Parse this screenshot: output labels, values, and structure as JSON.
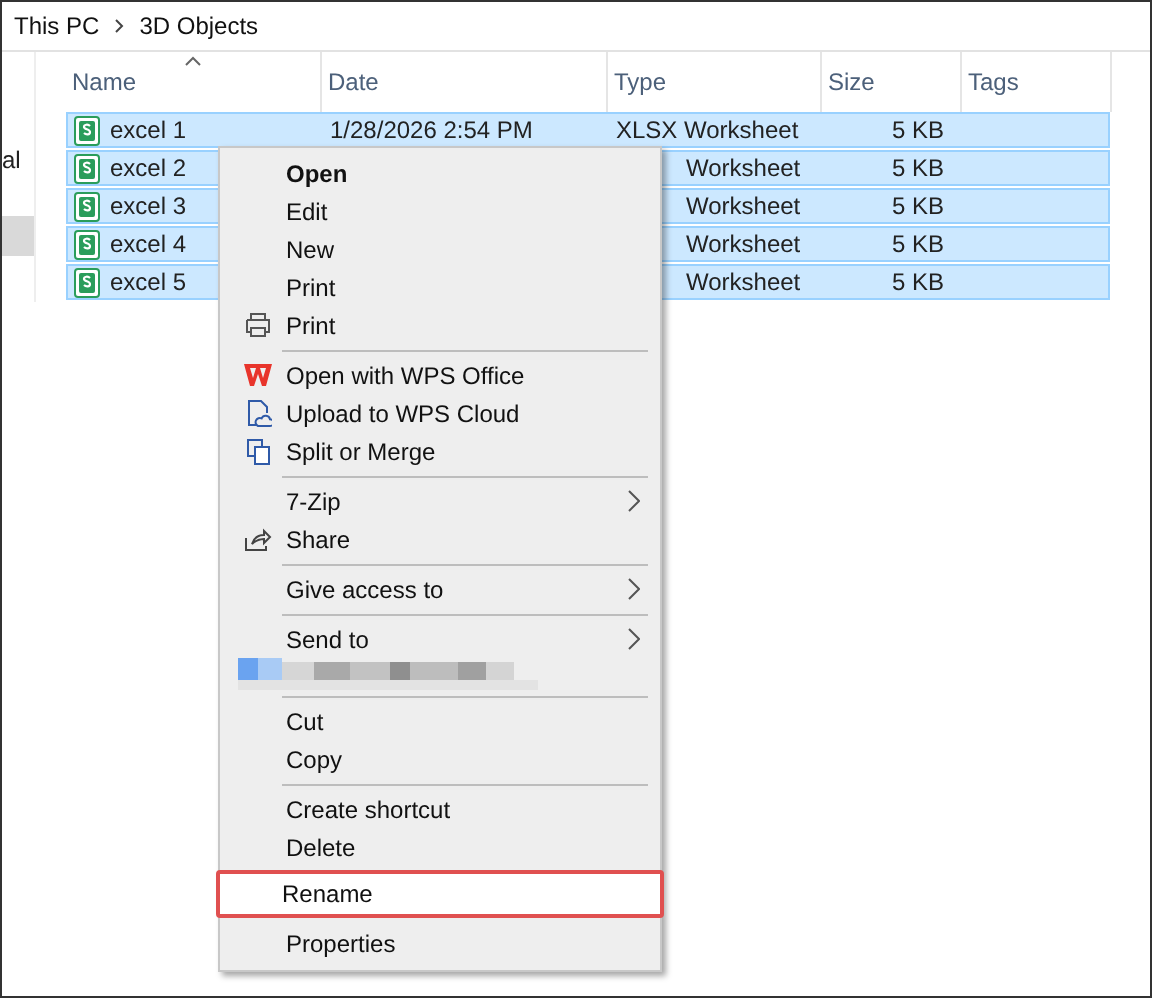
{
  "breadcrumb": [
    {
      "label": "This PC"
    },
    {
      "label": "3D Objects"
    }
  ],
  "sidebar": {
    "items": [
      {
        "label": "al",
        "selected": false
      },
      {
        "selected": true
      }
    ]
  },
  "table": {
    "columns": [
      {
        "label": "Name",
        "sorted": true
      },
      {
        "label": "Date",
        "sorted": false
      },
      {
        "label": "Type",
        "sorted": false
      },
      {
        "label": "Size",
        "sorted": false
      },
      {
        "label": "Tags",
        "sorted": false
      }
    ],
    "rows": [
      {
        "name": "excel 1",
        "date": "1/28/2026 2:54 PM",
        "type": "XLSX Worksheet",
        "size": "5 KB",
        "selected": true
      },
      {
        "name": "excel 2",
        "type": "Worksheet",
        "size": "5 KB",
        "selected": true
      },
      {
        "name": "excel 3",
        "type": "Worksheet",
        "size": "5 KB",
        "selected": true
      },
      {
        "name": "excel 4",
        "type": "Worksheet",
        "size": "5 KB",
        "selected": true
      },
      {
        "name": "excel 5",
        "type": "Worksheet",
        "size": "5 KB",
        "selected": true
      }
    ]
  },
  "context_menu": {
    "items": [
      {
        "kind": "item",
        "label": "Open",
        "default": true
      },
      {
        "kind": "item",
        "label": "Edit"
      },
      {
        "kind": "item",
        "label": "New"
      },
      {
        "kind": "item",
        "label": "Print"
      },
      {
        "kind": "print",
        "label": "Print"
      },
      {
        "kind": "separator"
      },
      {
        "kind": "wps",
        "label": "Open with WPS Office"
      },
      {
        "kind": "cloud",
        "label": "Upload to WPS Cloud"
      },
      {
        "kind": "merge",
        "label": "Split or Merge"
      },
      {
        "kind": "separator"
      },
      {
        "kind": "item",
        "label": "7-Zip",
        "submenu": true
      },
      {
        "kind": "share",
        "label": "Share"
      },
      {
        "kind": "separator"
      },
      {
        "kind": "item",
        "label": "Give access to",
        "submenu": true
      },
      {
        "kind": "separator"
      },
      {
        "kind": "item",
        "label": "Send to",
        "submenu": true
      },
      {
        "kind": "blurred"
      },
      {
        "kind": "separator"
      },
      {
        "kind": "item",
        "label": "Cut"
      },
      {
        "kind": "item",
        "label": "Copy"
      },
      {
        "kind": "separator"
      },
      {
        "kind": "item",
        "label": "Create shortcut"
      },
      {
        "kind": "item",
        "label": "Delete"
      },
      {
        "kind": "item",
        "label": "Rename",
        "highlighted": true
      },
      {
        "kind": "item",
        "label": "Properties"
      }
    ]
  }
}
